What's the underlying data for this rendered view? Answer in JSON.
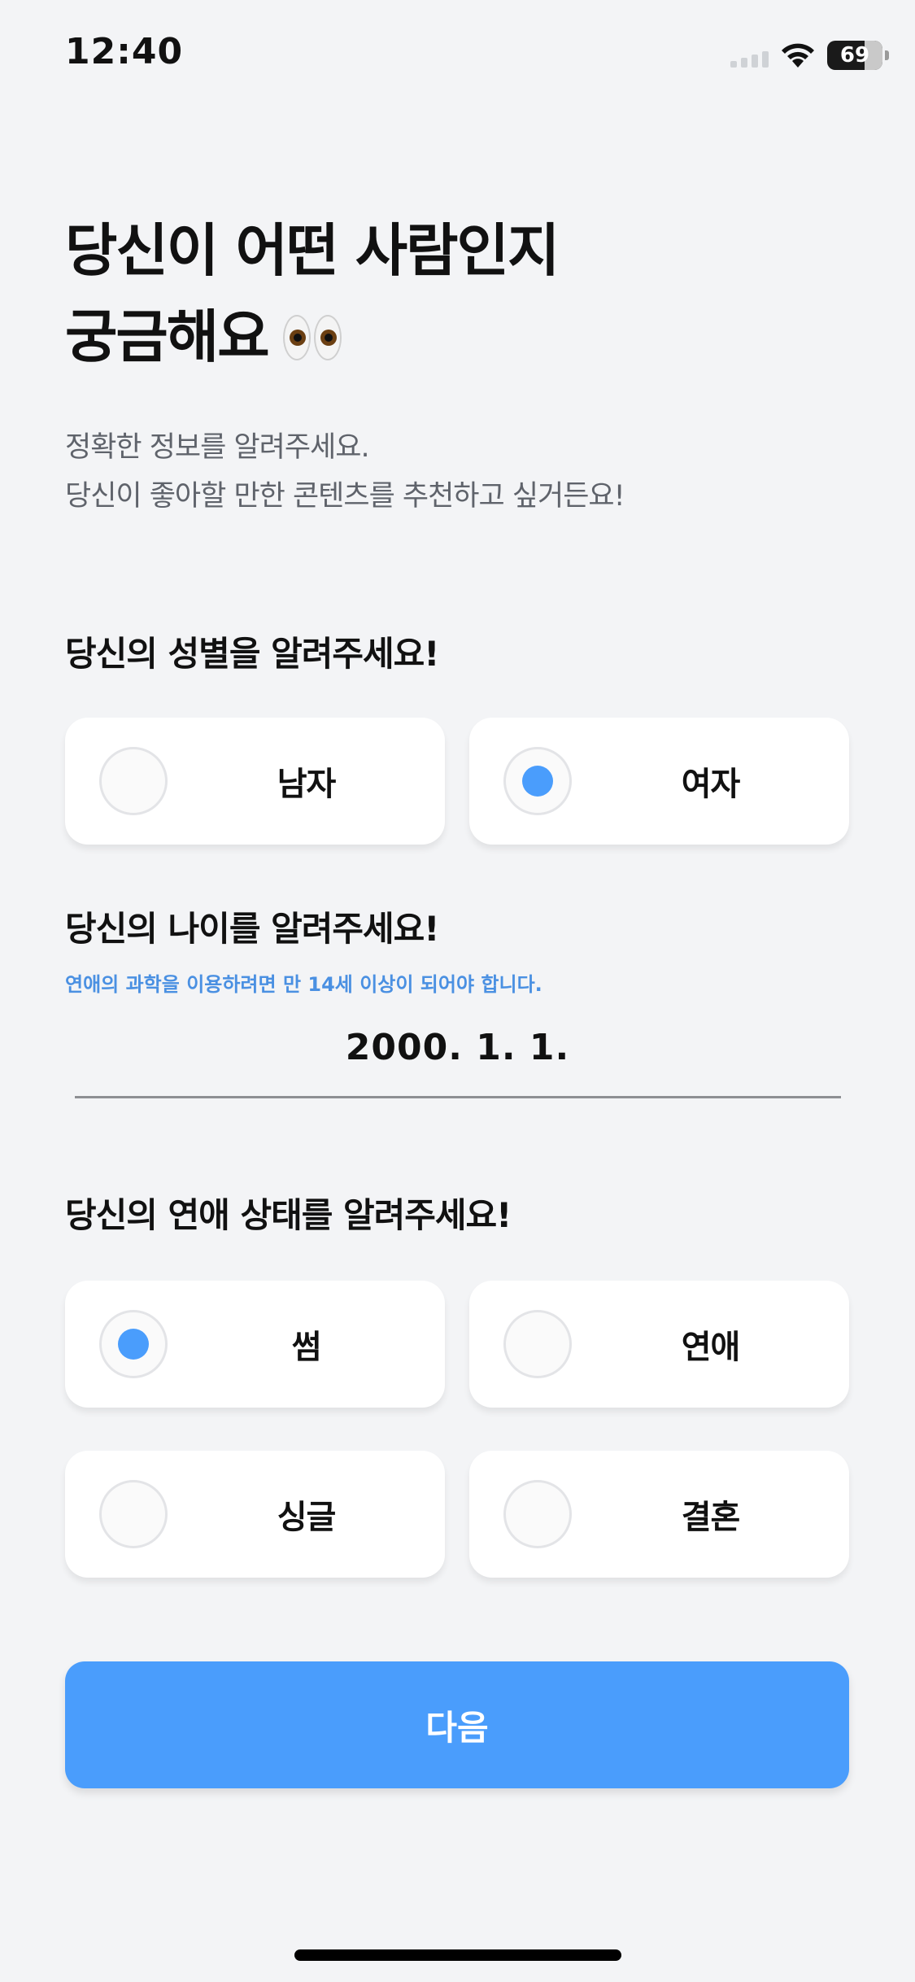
{
  "status_bar": {
    "time": "12:40",
    "battery": "69"
  },
  "header": {
    "title_line1": "당신이 어떤 사람인지",
    "title_line2": "궁금해요",
    "title_emoji": "eyes-emoji",
    "subtitle_line1": "정확한 정보를 알려주세요.",
    "subtitle_line2": "당신이 좋아할 만한 콘텐츠를 추천하고 싶거든요!"
  },
  "gender": {
    "label": "당신의 성별을 알려주세요!",
    "options": [
      {
        "label": "남자",
        "selected": false
      },
      {
        "label": "여자",
        "selected": true
      }
    ]
  },
  "age": {
    "label": "당신의 나이를 알려주세요!",
    "note": "연애의 과학을 이용하려면 만 14세 이상이 되어야 합니다.",
    "value": "2000. 1. 1."
  },
  "relationship": {
    "label": "당신의 연애 상태를 알려주세요!",
    "options": [
      {
        "label": "썸",
        "selected": true
      },
      {
        "label": "연애",
        "selected": false
      },
      {
        "label": "싱글",
        "selected": false
      },
      {
        "label": "결혼",
        "selected": false
      }
    ]
  },
  "next_button": {
    "label": "다음"
  },
  "colors": {
    "accent": "#4a9dfc",
    "note": "#4a90e2",
    "background": "#f3f4f6"
  }
}
